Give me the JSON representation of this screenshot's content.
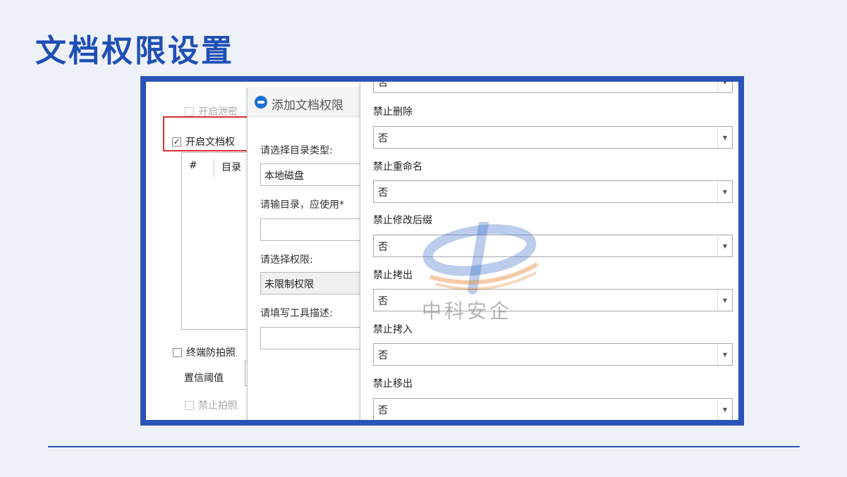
{
  "slide": {
    "title": "文档权限设置"
  },
  "back_panel": {
    "leak_check_label": "开启泄密",
    "doc_perm_label": "开启文档权",
    "doc_perm_checkmark": "✓",
    "table_headers": [
      "#",
      "目录"
    ],
    "anti_photo_label": "终端防拍照",
    "threshold_label": "置信阈值",
    "forbid_photo_label": "禁止拍照"
  },
  "dialog": {
    "title": "添加文档权限",
    "dir_type_label": "请选择目录类型:",
    "dir_type_value": "本地磁盘",
    "dir_input_label": "请输目录，应使用*",
    "dir_input_value": "",
    "perm_label": "请选择权限:",
    "perm_value": "未限制权限",
    "tool_desc_label": "请填写工具描述:",
    "tool_desc_value": ""
  },
  "right_panel": {
    "top_select_value": "否",
    "fields": [
      {
        "label": "禁止删除",
        "value": "否"
      },
      {
        "label": "禁止重命名",
        "value": "否"
      },
      {
        "label": "禁止修改后缀",
        "value": "否"
      },
      {
        "label": "禁止拷出",
        "value": "否"
      },
      {
        "label": "禁止拷入",
        "value": "否"
      },
      {
        "label": "禁止移出",
        "value": "否"
      }
    ],
    "dropdown_glyph": "▼"
  },
  "watermark": {
    "text": "中科安企"
  },
  "colors": {
    "title_blue": "#1f4fb5",
    "frame_blue": "#2b53b8",
    "highlight_red": "#d63232"
  }
}
